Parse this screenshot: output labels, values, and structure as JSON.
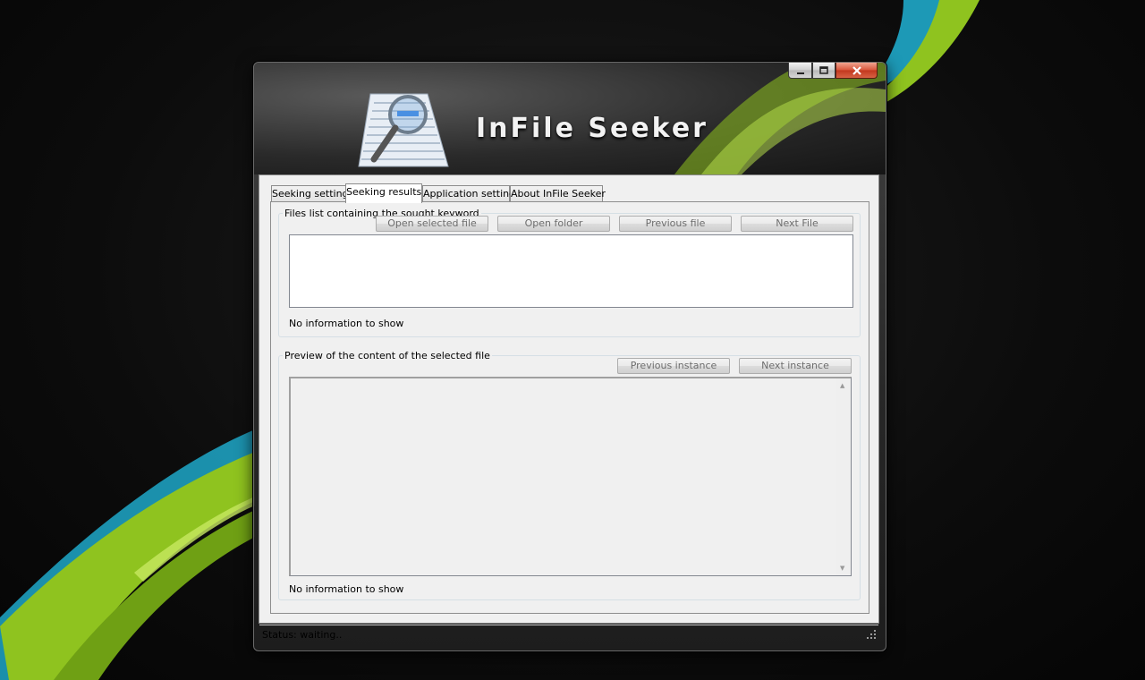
{
  "app": {
    "title": "InFile Seeker"
  },
  "window_controls": {
    "minimize": "minimize",
    "maximize": "maximize",
    "close": "close"
  },
  "tabs": [
    {
      "label": "Seeking setting",
      "active": false
    },
    {
      "label": "Seeking results",
      "active": true
    },
    {
      "label": "Application setting",
      "active": false
    },
    {
      "label": "About InFile Seeker",
      "active": false
    }
  ],
  "files_group": {
    "legend": "Files list containing the sought keyword",
    "buttons": {
      "open_selected": "Open selected file",
      "open_folder": "Open folder",
      "previous_file": "Previous file",
      "next_file": "Next File"
    },
    "info": "No information to show"
  },
  "preview_group": {
    "legend": "Preview of the content of the selected file",
    "buttons": {
      "previous_instance": "Previous instance",
      "next_instance": "Next instance"
    },
    "info": "No information to show"
  },
  "status": {
    "text": "Status: waiting.."
  },
  "colors": {
    "accent_green": "#8fc31f",
    "accent_cyan": "#1fa8c9",
    "close_button": "#c9432a"
  },
  "icons": {
    "logo": "magnifier-document-icon",
    "resize": "resize-grip-icon"
  }
}
